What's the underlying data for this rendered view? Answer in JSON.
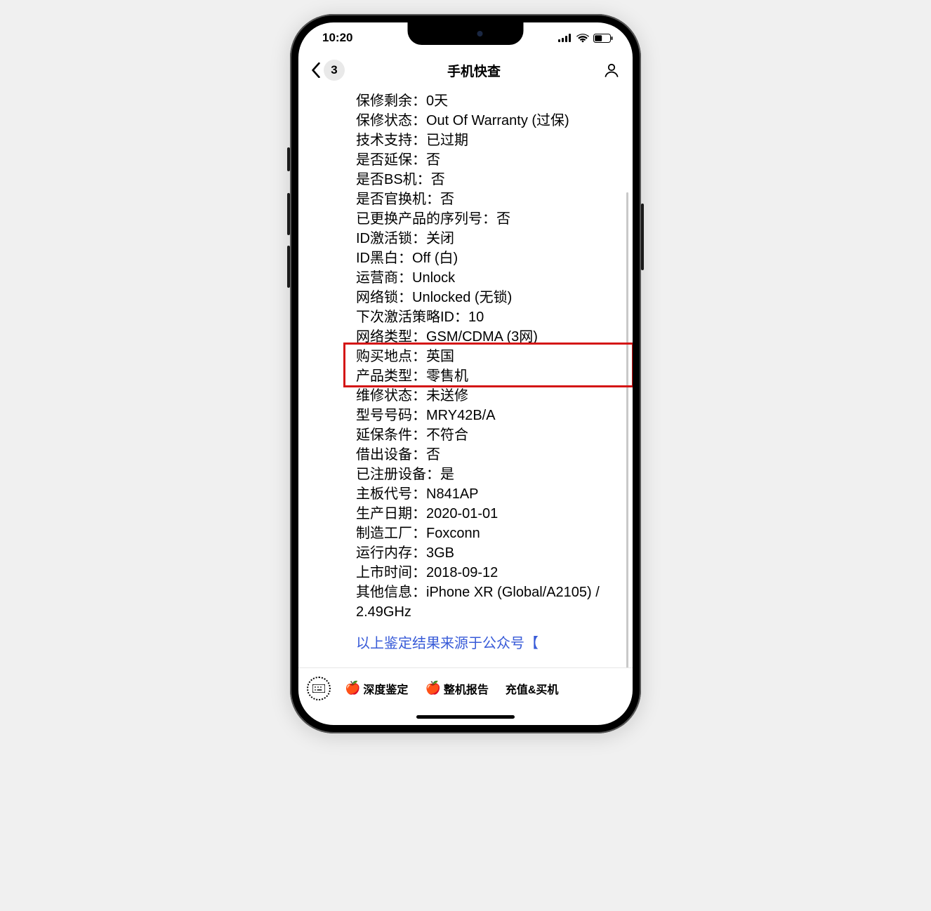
{
  "status": {
    "time": "10:20"
  },
  "nav": {
    "back_count": "3",
    "title": "手机快查"
  },
  "rows": [
    {
      "key": "保修剩余：",
      "value": "0天"
    },
    {
      "key": "保修状态：",
      "value": "Out Of Warranty (过保)"
    },
    {
      "key": "技术支持：",
      "value": "已过期"
    },
    {
      "key": "是否延保：",
      "value": "否"
    },
    {
      "key": "是否BS机：",
      "value": "否"
    },
    {
      "key": "是否官换机：",
      "value": "否"
    },
    {
      "key": "已更换产品的序列号：",
      "value": "否"
    },
    {
      "key": "ID激活锁：",
      "value": "关闭"
    },
    {
      "key": "ID黑白：",
      "value": "Off (白)"
    },
    {
      "key": "运营商：",
      "value": "Unlock"
    },
    {
      "key": "网络锁：",
      "value": "Unlocked (无锁)"
    },
    {
      "key": "下次激活策略ID：",
      "value": "10"
    },
    {
      "key": "网络类型：",
      "value": "GSM/CDMA (3网)"
    },
    {
      "key": "购买地点：",
      "value": "英国"
    },
    {
      "key": "产品类型：",
      "value": "零售机"
    },
    {
      "key": "维修状态：",
      "value": "未送修"
    },
    {
      "key": "型号号码：",
      "value": "MRY42B/A"
    },
    {
      "key": "延保条件：",
      "value": "不符合"
    },
    {
      "key": "借出设备：",
      "value": "否"
    },
    {
      "key": "已注册设备：",
      "value": "是"
    },
    {
      "key": "主板代号：",
      "value": "N841AP"
    },
    {
      "key": "生产日期：",
      "value": "2020-01-01"
    },
    {
      "key": "制造工厂：",
      "value": "Foxconn"
    },
    {
      "key": "运行内存：",
      "value": "3GB"
    },
    {
      "key": "上市时间：",
      "value": "2018-09-12"
    },
    {
      "key": "其他信息：",
      "value": "iPhone XR (Global/A2105) / 2.49GHz"
    }
  ],
  "highlighted_row_indices": [
    13,
    14
  ],
  "source_note": "以上鉴定结果来源于公众号【",
  "tabs": {
    "deep_check": "深度鉴定",
    "full_report": "整机报告",
    "recharge_buy": "充值&买机",
    "apple_emoji": "🍎"
  }
}
